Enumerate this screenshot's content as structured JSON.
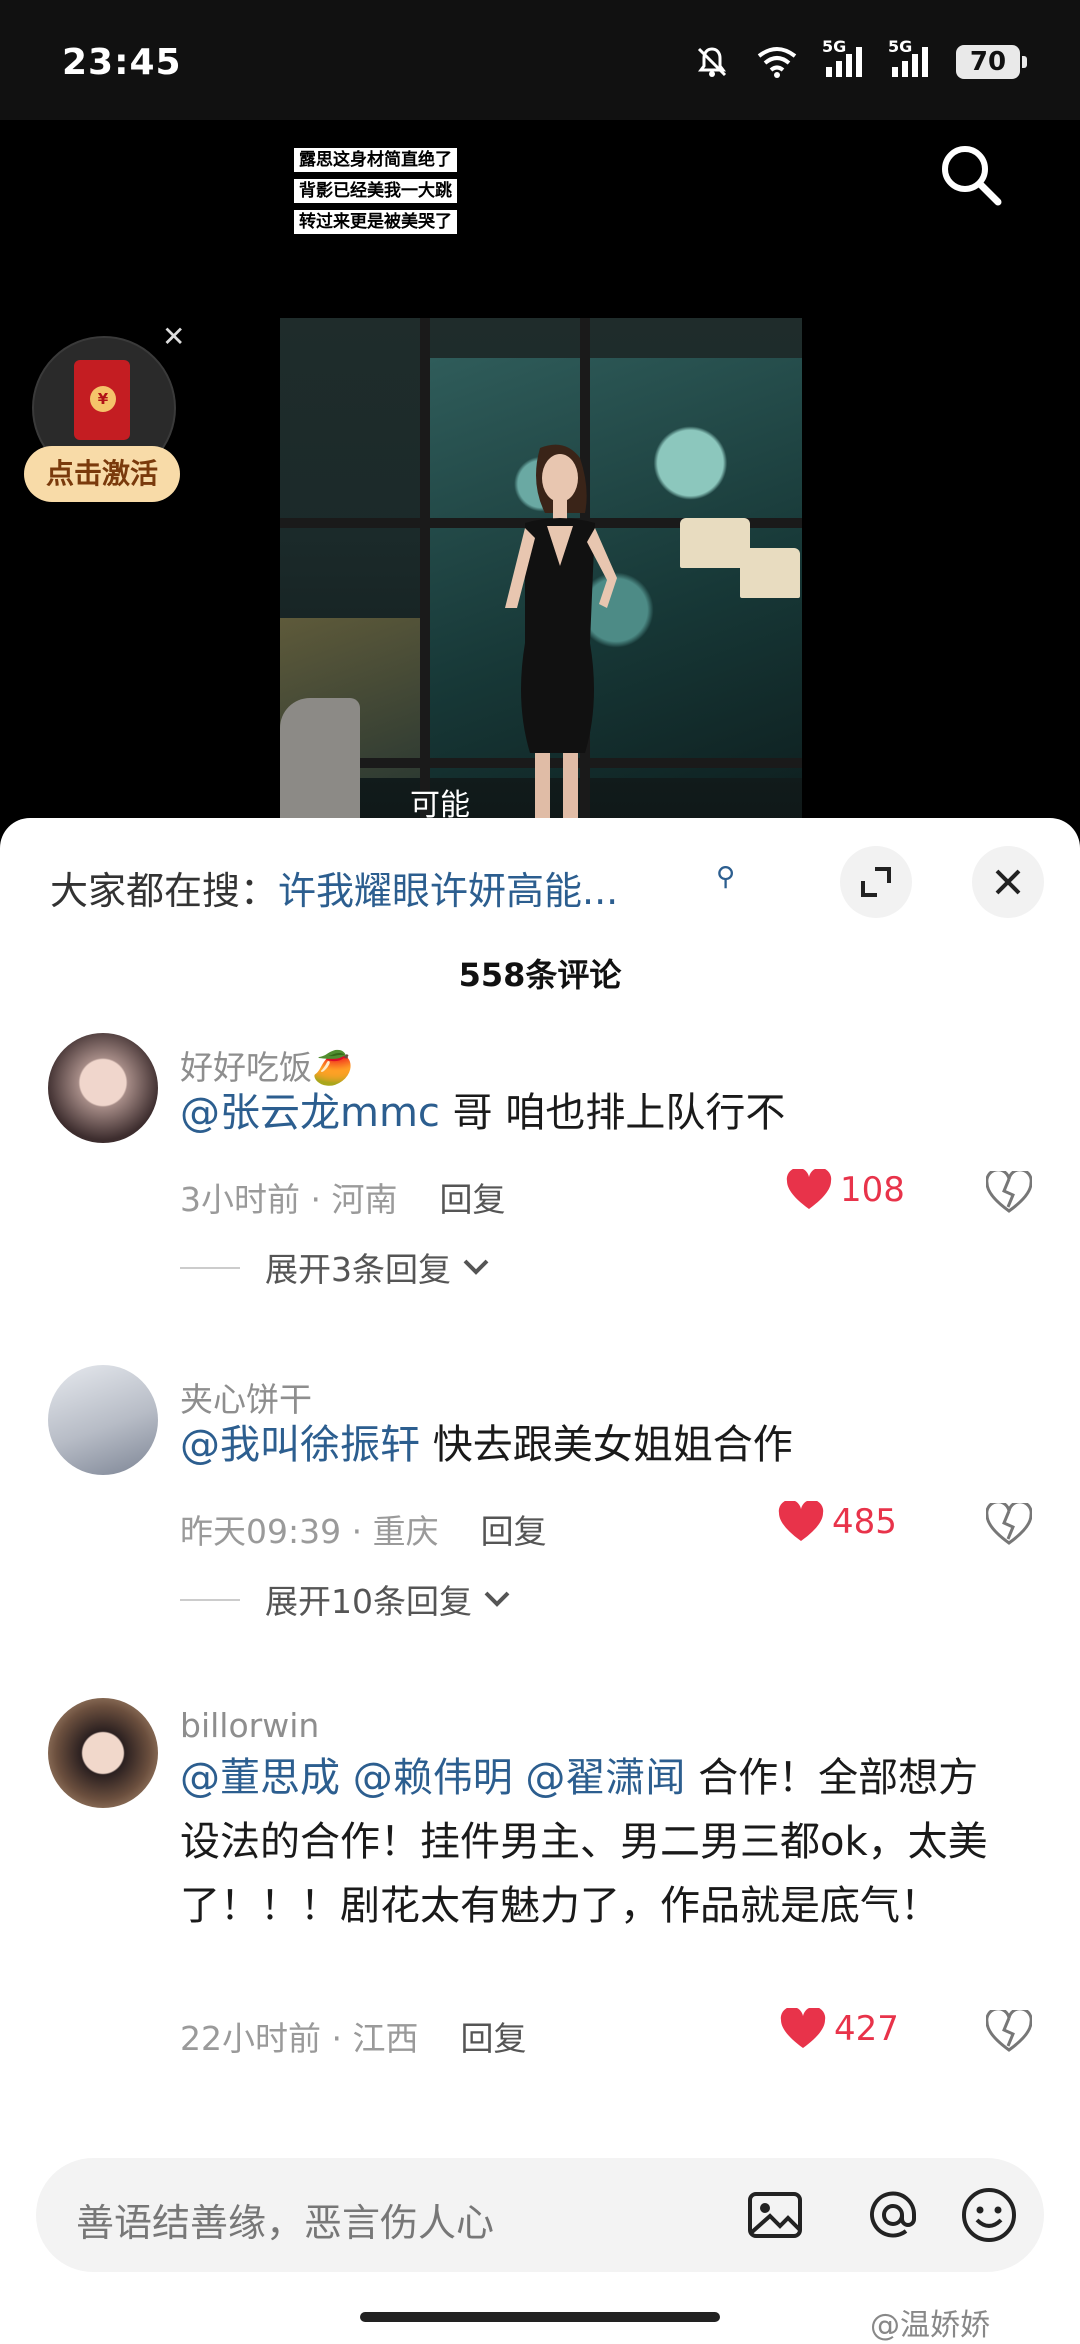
{
  "status": {
    "time": "23:45",
    "battery": "70",
    "net1": "5G",
    "net2": "5G"
  },
  "video": {
    "captions": [
      "露思这身材简直绝了",
      "背影已经美我一大跳",
      "转过来更是被美哭了"
    ],
    "subtitle": "可能",
    "promo_label": "点击激活",
    "promo_coin": "¥"
  },
  "panel": {
    "hot_prefix": "大家都在搜：",
    "hot_query": "许我耀眼许妍高能...",
    "comment_count": "558条评论"
  },
  "comments": [
    {
      "name": "好好吃饭🥭",
      "mention": "@张云龙mmc",
      "text": " 哥 咱也排上队行不",
      "time": "3小时前 · 河南",
      "reply": "回复",
      "likes": "108",
      "expand": "展开3条回复"
    },
    {
      "name": "夹心饼干",
      "mention": "@我叫徐振轩",
      "text": " 快去跟美女姐姐合作",
      "time": "昨天09:39 · 重庆",
      "reply": "回复",
      "likes": "485",
      "expand": "展开10条回复"
    },
    {
      "name": "billorwin",
      "mention": "@董思成 @赖伟明 @翟潇闻",
      "text": " 合作！全部想方设法的合作！挂件男主、男二男三都ok，太美了！！！剧花太有魅力了，作品就是底气！",
      "time": "22小时前 · 江西",
      "reply": "回复",
      "likes": "427"
    }
  ],
  "input": {
    "placeholder": "善语结善缘，恶言伤人心"
  },
  "watermark": "@温娇娇",
  "colors": {
    "like": "#e8334a",
    "mention": "#2c5e8f",
    "promo_bg": "#f8dba8"
  }
}
